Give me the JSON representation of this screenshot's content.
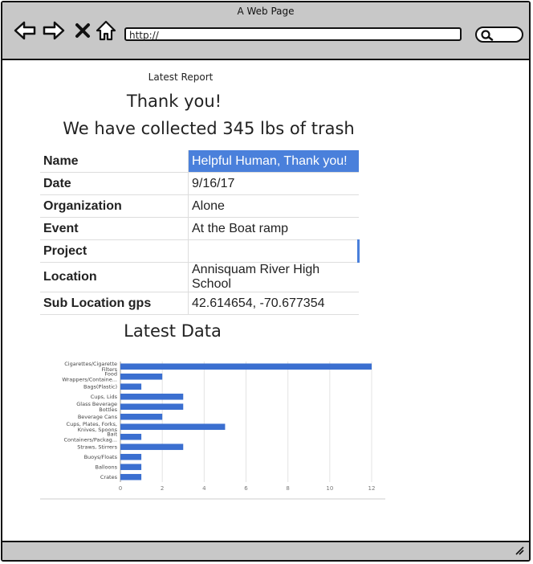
{
  "window": {
    "title": "A Web Page"
  },
  "toolbar": {
    "url": "http://",
    "buttons": [
      "back-icon",
      "forward-icon",
      "close-icon",
      "home-icon"
    ],
    "search_icon": "search-icon"
  },
  "report": {
    "label": "Latest Report",
    "thanks": "Thank you!",
    "collected": "We have collected 345 lbs of trash"
  },
  "table": [
    {
      "key": "Name",
      "value": "Helpful Human, Thank you!"
    },
    {
      "key": "Date",
      "value": "9/16/17"
    },
    {
      "key": "Organization",
      "value": "Alone"
    },
    {
      "key": "Event",
      "value": "At the Boat ramp"
    },
    {
      "key": "Project",
      "value": ""
    },
    {
      "key": "Location",
      "value": "Annisquam River High School"
    },
    {
      "key": "Sub Location gps",
      "value": "42.614654, -70.677354"
    }
  ],
  "latest_data": {
    "title": "Latest Data"
  },
  "colors": {
    "accent": "#3b6fd0",
    "frame": "#c8c8c8"
  },
  "chart_data": {
    "type": "bar",
    "orientation": "horizontal",
    "categories": [
      "Cigarettes/Cigarette Filters",
      "Food Wrappers/Containers",
      "Bags(Plastic)",
      "Cups, Lids",
      "Glass Beverage Bottles",
      "Beverage Cans",
      "Cups, Plates, Forks, Knives, Spoons",
      "Bait Containers/Packaging",
      "Straws, Stirrers",
      "Buoys/Floats",
      "Balloons",
      "Crates"
    ],
    "category_labels": [
      [
        "Cigarettes/Cigarette",
        "Filters"
      ],
      [
        "Food",
        "Wrappers/Containe..."
      ],
      [
        "Bags(Plastic)"
      ],
      [
        "Cups, Lids"
      ],
      [
        "Glass Beverage",
        "Bottles"
      ],
      [
        "Beverage Cans"
      ],
      [
        "Cups, Plates, Forks,",
        "Knives, Spoons"
      ],
      [
        "Bait",
        "Containers/Packag..."
      ],
      [
        "Straws, Stirrers"
      ],
      [
        "Buoys/Floats"
      ],
      [
        "Balloons"
      ],
      [
        "Crates"
      ]
    ],
    "values": [
      12,
      2,
      1,
      3,
      3,
      2,
      5,
      1,
      3,
      1,
      1,
      1
    ],
    "xlim": [
      0,
      12
    ],
    "xticks": [
      "0",
      "2",
      "4",
      "6",
      "8",
      "10",
      "12"
    ],
    "grid": true,
    "color": "#3b6fd0"
  }
}
